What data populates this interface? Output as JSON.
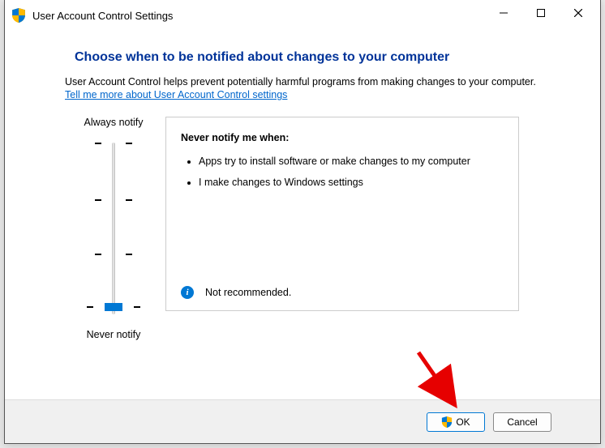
{
  "window": {
    "title": "User Account Control Settings"
  },
  "heading": "Choose when to be notified about changes to your computer",
  "description": "User Account Control helps prevent potentially harmful programs from making changes to your computer.",
  "learn_more": "Tell me more about User Account Control settings",
  "slider": {
    "top_label": "Always notify",
    "bottom_label": "Never notify",
    "levels": 4,
    "current_level": 0
  },
  "info": {
    "title": "Never notify me when:",
    "bullets": [
      "Apps try to install software or make changes to my computer",
      "I make changes to Windows settings"
    ],
    "footer": "Not recommended."
  },
  "buttons": {
    "ok": "OK",
    "cancel": "Cancel"
  }
}
